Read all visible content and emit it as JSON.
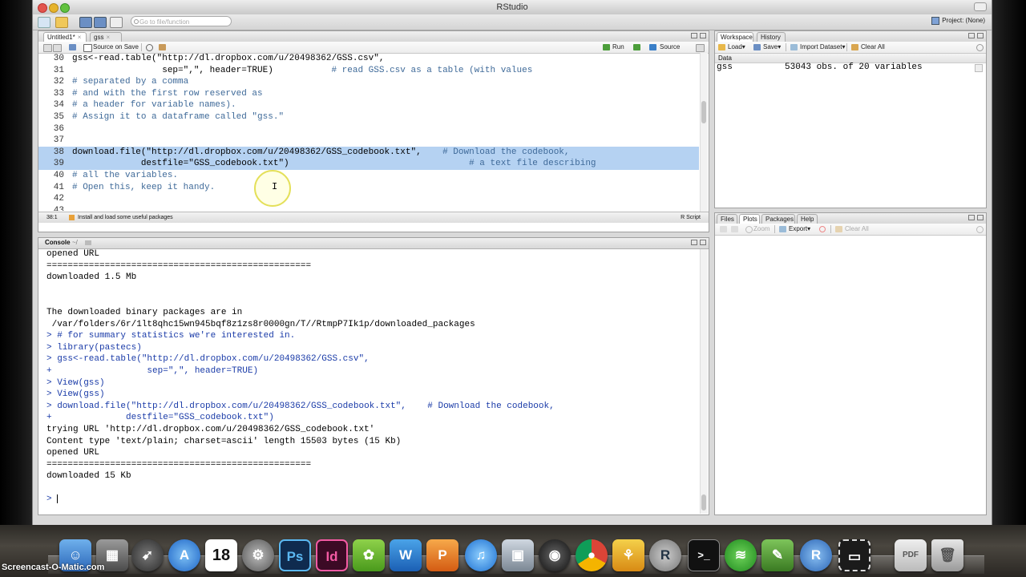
{
  "window": {
    "title": "RStudio"
  },
  "toolbar": {
    "goto_placeholder": "Go to file/function",
    "project_label": "Project: (None)"
  },
  "editor": {
    "tabs": [
      {
        "label": "Untitled1*"
      },
      {
        "label": "gss"
      }
    ],
    "source_on_save": "Source on Save",
    "run_label": "Run",
    "source_label": "Source",
    "lines": [
      {
        "num": "30",
        "text": "gss<-read.table(\"http://dl.dropbox.com/u/20498362/GSS.csv\",",
        "comment": "",
        "highlight": false
      },
      {
        "num": "31",
        "text": "                 sep=\",\", header=TRUE)",
        "comment": "           # read GSS.csv as a table (with values",
        "highlight": false
      },
      {
        "num": "32",
        "text": "",
        "comment": "# separated by a comma",
        "highlight": false
      },
      {
        "num": "33",
        "text": "",
        "comment": "# and with the first row reserved as",
        "highlight": false
      },
      {
        "num": "34",
        "text": "",
        "comment": "# a header for variable names).",
        "highlight": false
      },
      {
        "num": "35",
        "text": "",
        "comment": "# Assign it to a dataframe called \"gss.\"",
        "highlight": false
      },
      {
        "num": "36",
        "text": "",
        "comment": "",
        "highlight": false
      },
      {
        "num": "37",
        "text": "",
        "comment": "",
        "highlight": false
      },
      {
        "num": "38",
        "text": "download.file(\"http://dl.dropbox.com/u/20498362/GSS_codebook.txt\",",
        "comment": "    # Download the codebook,",
        "highlight": true
      },
      {
        "num": "39",
        "text": "             destfile=\"GSS_codebook.txt\")",
        "comment": "                                  # a text file describing",
        "highlight": true
      },
      {
        "num": "40",
        "text": "",
        "comment": "# all the variables.",
        "highlight": false
      },
      {
        "num": "41",
        "text": "",
        "comment": "# Open this, keep it handy.",
        "highlight": false
      },
      {
        "num": "42",
        "text": "",
        "comment": "",
        "highlight": false
      },
      {
        "num": "43",
        "text": "",
        "comment": "",
        "highlight": false
      }
    ],
    "status_pos": "38:1",
    "status_section": "Install and load some useful packages",
    "status_type": "R Script"
  },
  "console": {
    "title": "Console",
    "path": "~/",
    "lines": [
      {
        "text": "opened URL",
        "kind": "out"
      },
      {
        "text": "==================================================",
        "kind": "out"
      },
      {
        "text": "downloaded 1.5 Mb",
        "kind": "out"
      },
      {
        "text": "",
        "kind": "out"
      },
      {
        "text": "",
        "kind": "out"
      },
      {
        "text": "The downloaded binary packages are in",
        "kind": "out"
      },
      {
        "text": " /var/folders/6r/1lt8qhc15wn945bqf8z1zs8r0000gn/T//RtmpP7Ik1p/downloaded_packages",
        "kind": "out"
      },
      {
        "text": "> # for summary statistics we're interested in.",
        "kind": "in"
      },
      {
        "text": "> library(pastecs)",
        "kind": "in"
      },
      {
        "text": "> gss<-read.table(\"http://dl.dropbox.com/u/20498362/GSS.csv\",",
        "kind": "in"
      },
      {
        "text": "+                  sep=\",\", header=TRUE)",
        "kind": "in"
      },
      {
        "text": "> View(gss)",
        "kind": "in"
      },
      {
        "text": "> View(gss)",
        "kind": "in"
      },
      {
        "text": "> download.file(\"http://dl.dropbox.com/u/20498362/GSS_codebook.txt\",    # Download the codebook,",
        "kind": "in"
      },
      {
        "text": "+              destfile=\"GSS_codebook.txt\")",
        "kind": "in"
      },
      {
        "text": "trying URL 'http://dl.dropbox.com/u/20498362/GSS_codebook.txt'",
        "kind": "out"
      },
      {
        "text": "Content type 'text/plain; charset=ascii' length 15503 bytes (15 Kb)",
        "kind": "out"
      },
      {
        "text": "opened URL",
        "kind": "out"
      },
      {
        "text": "==================================================",
        "kind": "out"
      },
      {
        "text": "downloaded 15 Kb",
        "kind": "out"
      },
      {
        "text": "",
        "kind": "out"
      },
      {
        "text": "> ",
        "kind": "in"
      }
    ]
  },
  "workspace": {
    "tabs": [
      {
        "label": "Workspace"
      },
      {
        "label": "History"
      }
    ],
    "load_label": "Load",
    "save_label": "Save",
    "import_label": "Import Dataset",
    "clear_label": "Clear All",
    "section": "Data",
    "item_name": "gss",
    "item_desc": "53043 obs. of 20 variables"
  },
  "files_pane": {
    "tabs": [
      {
        "label": "Files"
      },
      {
        "label": "Plots"
      },
      {
        "label": "Packages"
      },
      {
        "label": "Help"
      }
    ],
    "zoom_label": "Zoom",
    "export_label": "Export",
    "clear_label": "Clear All"
  },
  "dock": {
    "watermark": "Screencast-O-Matic.com",
    "calendar_day": "18",
    "ps_label": "Ps",
    "id_label": "Id",
    "r_label": "R"
  },
  "colors": {
    "accent": "#3f6a99",
    "selection": "#b5d2f2",
    "console_input": "#1a3ba8"
  }
}
